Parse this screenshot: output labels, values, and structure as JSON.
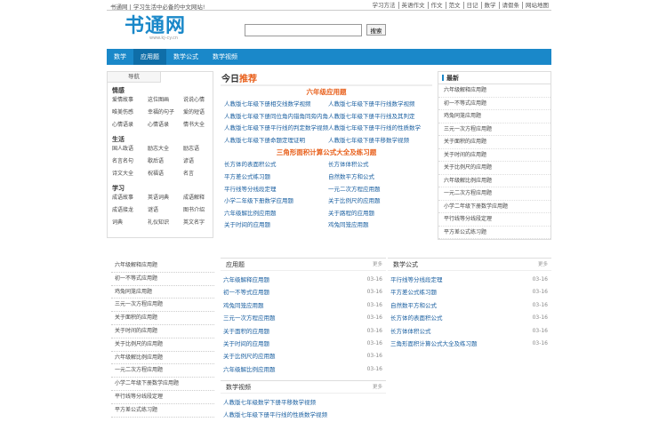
{
  "topbar": {
    "welcome": "书通网 | 学习生活中必备的中文网站!",
    "links": [
      "学习方法",
      "英语作文",
      "作文",
      "范文",
      "日记",
      "数学",
      "请假条",
      "网站地图"
    ]
  },
  "logo": {
    "text": "书通网",
    "url": "www.kj-cy.cn"
  },
  "search": {
    "value": "",
    "button": "搜索"
  },
  "nav": [
    "数学",
    "应用题",
    "数学公式",
    "数学视频"
  ],
  "leftnav": {
    "header": "导航",
    "groups": [
      {
        "title": "情感",
        "items": [
          "爱情故事",
          "这位图画",
          "说说心情",
          "唯美伤感",
          "幸福的句子",
          "爱的短语",
          "心情语录",
          "心情语录",
          "情书大全"
        ]
      },
      {
        "title": "生活",
        "items": [
          "国人政语",
          "励志大全",
          "励志语",
          "名言名句",
          "歇后语",
          "谚语",
          "诗文大全",
          "祝福语",
          "名言"
        ]
      },
      {
        "title": "学习",
        "items": [
          "成语故事",
          "英语词典",
          "成语解释",
          "成语接龙",
          "谜语",
          "图书介绍",
          "词典",
          "礼仪知识",
          "英文名字"
        ]
      }
    ]
  },
  "today": {
    "title_a": "今日",
    "title_b": "推荐",
    "sec1": "六年级应用题",
    "sec1_items": [
      "人教版七年级下册相交线数学视频",
      "人教版七年级下册平行线数学视频",
      "人教版七年级下册同位角内错角同旁内角",
      "人教版七年级下册平行线及其判定",
      "人教版七年级下册平行线的判定数学视频",
      "人教版七年级下册平行线的性质数学",
      "人教版七年级下册命题定理证明",
      "人教版七年级下册平移数学视频"
    ],
    "sec2": "三角形面积计算公式大全及练习题",
    "sec2_items": [
      "长方体的表面积公式",
      "长方体体积公式",
      "平方差公式练习题",
      "自然数平方和公式",
      "平行线等分线段定理",
      "一元二次方程应用题",
      "小学二年级下册数学应用题",
      "关于比例尺的应用题",
      "六年级解比例应用题",
      "关于路程的应用题",
      "关于时间的应用题",
      "鸡兔同笼应用题"
    ]
  },
  "latest": {
    "title": "最新",
    "items": [
      "六年级解释应用题",
      "初一不等式应用题",
      "鸡兔同笼应用题",
      "三元一次方程应用题",
      "关于面积的应用题",
      "关于时间的应用题",
      "关于比例尺的应用题",
      "六年级解比例应用题",
      "一元二次方程应用题",
      "小学二年级下册数学应用题",
      "平行线等分线段定理",
      "平方差公式练习题"
    ]
  },
  "leftlist": [
    "六年级解释应用题",
    "初一不等式应用题",
    "鸡兔同笼应用题",
    "三元一次方程应用题",
    "关于面积的应用题",
    "关于时间的应用题",
    "关于比例尺的应用题",
    "六年级解比例应用题",
    "一元二次方程应用题",
    "小学二年级下册数学应用题",
    "平行线等分线段定理",
    "平方差公式练习题"
  ],
  "box_app": {
    "title": "应用题",
    "more": "更多",
    "items": [
      [
        "六年级解释应用题",
        "03-16"
      ],
      [
        "初一不等式应用题",
        "03-16"
      ],
      [
        "鸡兔同笼应用题",
        "03-16"
      ],
      [
        "三元一次方程应用题",
        "03-16"
      ],
      [
        "关于面积的应用题",
        "03-16"
      ],
      [
        "关于时间的应用题",
        "03-16"
      ],
      [
        "关于比例尺的应用题",
        "03-16"
      ],
      [
        "六年级解比例应用题",
        "03-16"
      ]
    ]
  },
  "box_formula": {
    "title": "数学公式",
    "more": "更多",
    "items": [
      [
        "平行线等分线段定理",
        "03-16"
      ],
      [
        "平方差公式练习题",
        "03-16"
      ],
      [
        "自然数平方和公式",
        "03-16"
      ],
      [
        "长方体的表面积公式",
        "03-16"
      ],
      [
        "长方体体积公式",
        "03-16"
      ],
      [
        "三角形面积计算公式大全及练习题",
        "03-16"
      ]
    ]
  },
  "box_video": {
    "title": "数学视频",
    "more": "更多",
    "items": [
      [
        "人教版七年级数学下册平移数学视频",
        ""
      ],
      [
        "人教版七年级下册平行线的性质数学视频",
        ""
      ]
    ]
  }
}
